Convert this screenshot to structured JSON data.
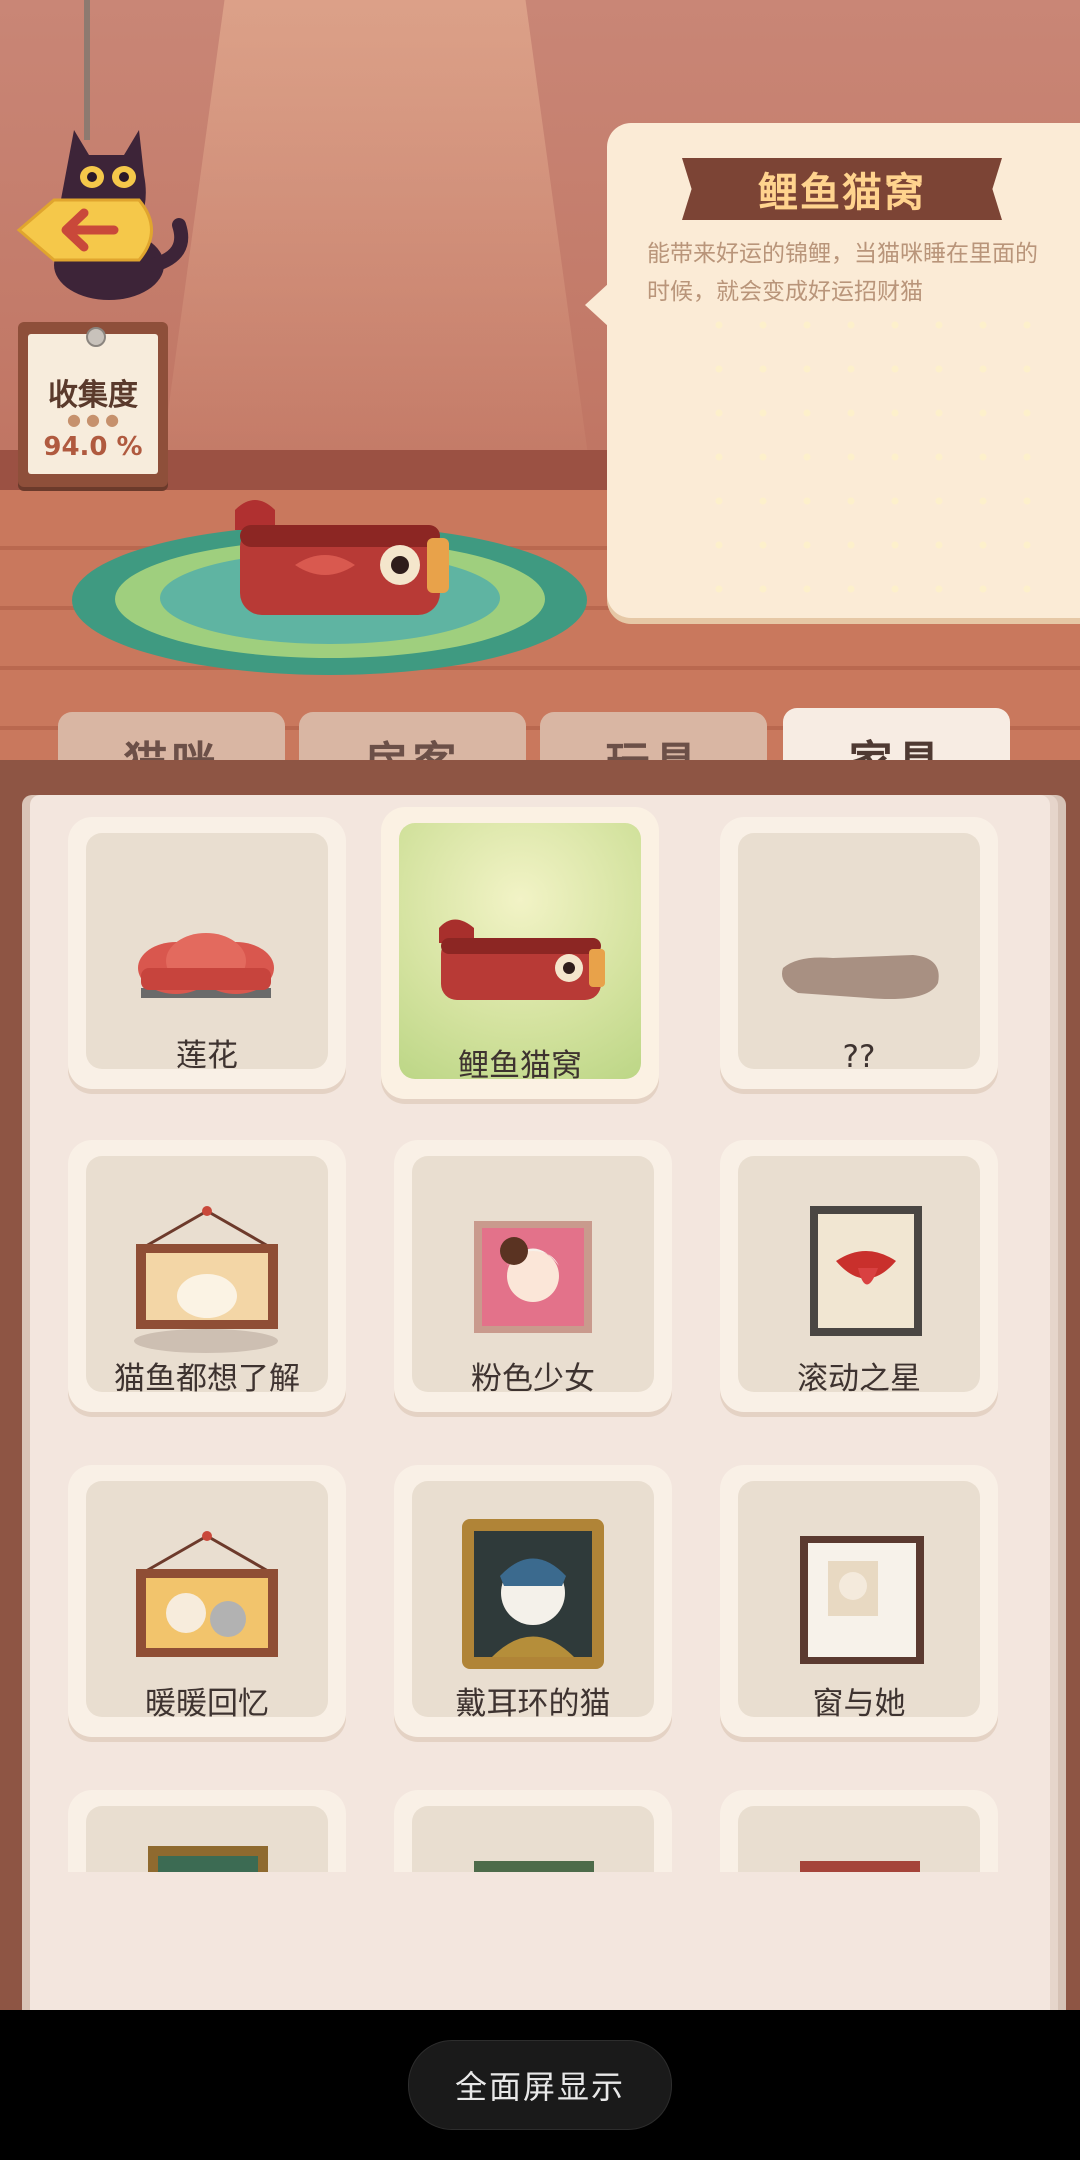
{
  "collection": {
    "label": "收集度",
    "value": "94.0 %",
    "paw_icon": "paw-icon"
  },
  "detail": {
    "title": "鲤鱼猫窝",
    "description": "能带来好运的锦鲤，当猫咪睡在里面的时候，就会变成好运招财猫"
  },
  "tabs": [
    {
      "label": "猫咪",
      "active": false
    },
    {
      "label": "房客",
      "active": false
    },
    {
      "label": "玩具",
      "active": false
    },
    {
      "label": "家具",
      "active": true
    }
  ],
  "items": [
    {
      "name": "莲花",
      "icon": "lotus-bed-icon"
    },
    {
      "name": "鲤鱼猫窝",
      "icon": "koi-bed-icon",
      "selected": true
    },
    {
      "name": "??",
      "icon": "unknown-item-icon"
    },
    {
      "name": "猫鱼都想了解",
      "icon": "fish-painting-icon"
    },
    {
      "name": "粉色少女",
      "icon": "pink-girl-painting-icon"
    },
    {
      "name": "滚动之星",
      "icon": "rolling-star-poster-icon"
    },
    {
      "name": "暖暖回忆",
      "icon": "memory-painting-icon"
    },
    {
      "name": "戴耳环的猫",
      "icon": "pearl-earring-cat-icon"
    },
    {
      "name": "窗与她",
      "icon": "window-cat-frame-icon"
    },
    {
      "name": "",
      "icon": "framed-painting-icon"
    },
    {
      "name": "",
      "icon": "framed-painting-icon"
    },
    {
      "name": "",
      "icon": "framed-painting-icon"
    }
  ],
  "system": {
    "fullscreen_label": "全面屏显示"
  },
  "colors": {
    "accent_ribbon": "#7c4435",
    "selected_card": "#d3e29e",
    "tab_active": "#f7ece3"
  }
}
